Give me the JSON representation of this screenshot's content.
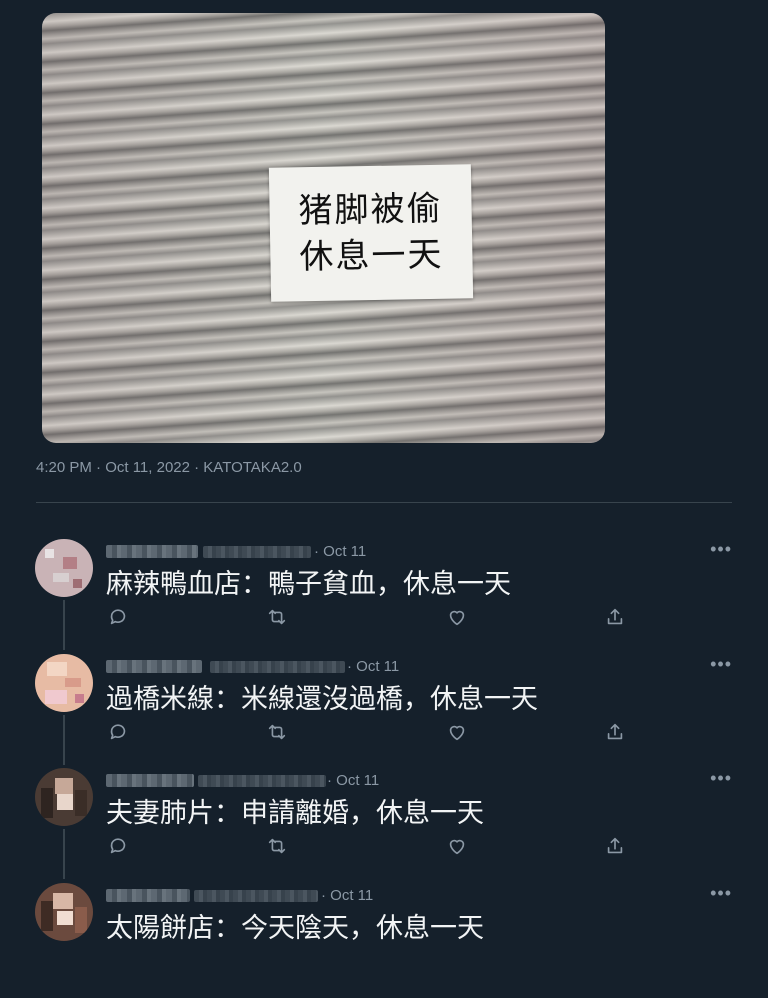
{
  "tweet": {
    "photo_sign_lines": [
      "猪脚被偷",
      "休息一天"
    ],
    "meta": "4:20 PM · Oct 11, 2022 · KATOTAKA2.0"
  },
  "replies": [
    {
      "date": "· Oct 11",
      "text": "麻辣鴨血店：鴨子貧血，休息一天"
    },
    {
      "date": "· Oct 11",
      "text": "過橋米線：米線還沒過橋，休息一天"
    },
    {
      "date": "· Oct 11",
      "text": "夫妻肺片：申請離婚，休息一天"
    },
    {
      "date": "· Oct 11",
      "text": "太陽餅店：今天陰天，休息一天"
    }
  ],
  "icons": {
    "reply": "reply-icon",
    "retweet": "retweet-icon",
    "like": "heart-icon",
    "share": "share-icon",
    "more": "more-icon"
  },
  "more_label": "•••",
  "colors": {
    "background": "#15202b",
    "text": "#e7e9ea",
    "secondary": "#8b98a5",
    "divider": "#38444d"
  }
}
